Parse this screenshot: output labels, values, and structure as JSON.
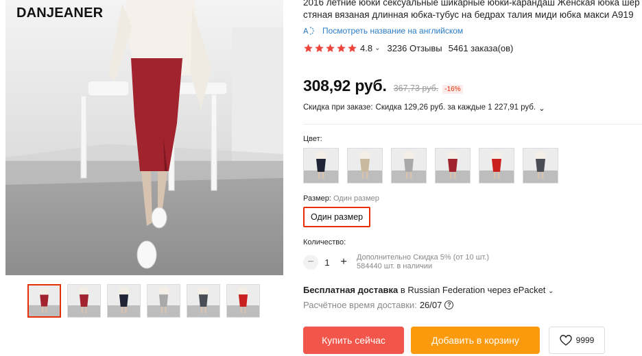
{
  "brand": {
    "logo": "DANJEANER"
  },
  "product": {
    "title_line1": "2016 летние юбки сексуальные шикарные юбки-карандаш Женская юбка шер",
    "title_line2": "стяная вязаная длинная юбка-тубус на бедрах талия миди юбка макси A919",
    "translate_link": "Посмотреть название на английском",
    "translate_icon": "translate-icon"
  },
  "rating": {
    "value": "4.8",
    "stars": 5,
    "reviews": "3236 Отзывы",
    "orders": "5461 заказа(ов)",
    "color": "#f0443a"
  },
  "price": {
    "current": "308,92 руб.",
    "old": "367,73 руб.",
    "discount": "-16%"
  },
  "promo": {
    "label": "Скидка при заказе:",
    "text": "Скидка 129,26 руб. за каждые 1 227,91 руб."
  },
  "options": {
    "color_label": "Цвет:",
    "colors": [
      "black",
      "beige",
      "gray",
      "wine-red",
      "red",
      "dark-gray"
    ],
    "size_label": "Размер:",
    "size_selected_label": "Один размер",
    "size_option": "Один размер"
  },
  "quantity": {
    "label": "Количество:",
    "value": "1",
    "minus": "−",
    "plus": "+",
    "note1": "Дополнительно Скидка 5% (от 10 шт.)",
    "note2": "584440 шт. в наличии"
  },
  "shipping": {
    "free_label": "Бесплатная доставка",
    "destination": "в Russian Federation через ePacket",
    "eta_label": "Расчётное время доставки:",
    "eta_date": "26/07"
  },
  "actions": {
    "buy_now": "Купить сейчас",
    "add_to_cart": "Добавить в корзину",
    "wishlist_count": "9999",
    "buy_color": "#f2554a",
    "cart_color": "#fb9a0c"
  },
  "gallery": {
    "thumbnails": [
      "wine-red",
      "wine-red",
      "black",
      "gray",
      "dark-gray",
      "red"
    ],
    "active_index": 0
  }
}
